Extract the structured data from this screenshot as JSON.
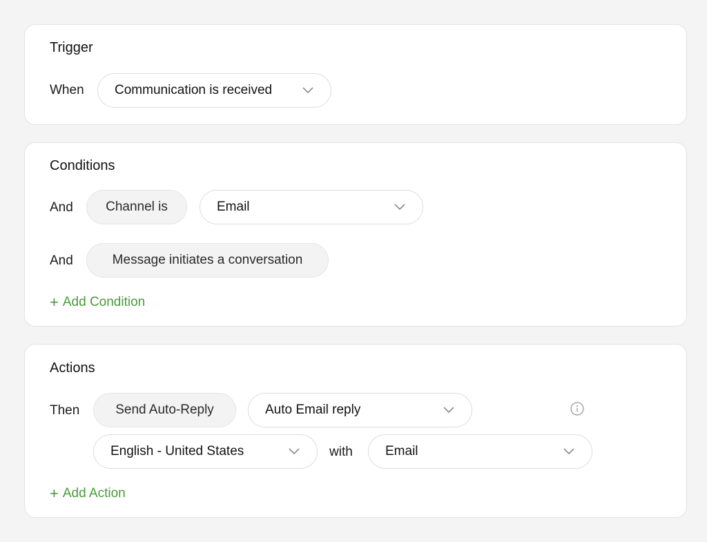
{
  "trigger": {
    "title": "Trigger",
    "when_label": "When",
    "event_select": {
      "value": "Communication is received",
      "icon": "chevron-down-icon"
    }
  },
  "conditions": {
    "title": "Conditions",
    "rows": [
      {
        "connector": "And",
        "field": "Channel is",
        "value_select": {
          "value": "Email",
          "icon": "chevron-down-icon"
        }
      },
      {
        "connector": "And",
        "field": "Message initiates a conversation"
      }
    ],
    "add_label": "Add Condition",
    "add_icon": "plus-icon"
  },
  "actions": {
    "title": "Actions",
    "then_label": "Then",
    "action": "Send Auto-Reply",
    "template_select": {
      "value": "Auto Email reply",
      "icon": "chevron-down-icon"
    },
    "language_select": {
      "value": "English - United States",
      "icon": "chevron-down-icon"
    },
    "with_label": "with",
    "channel_select": {
      "value": "Email",
      "icon": "chevron-down-icon"
    },
    "info_icon": "info-icon",
    "add_label": "Add Action",
    "add_icon": "plus-icon"
  },
  "colors": {
    "accent_green": "#4a9a3a",
    "background": "#f4f4f4",
    "card": "#ffffff",
    "static_pill": "#f3f3f3"
  }
}
